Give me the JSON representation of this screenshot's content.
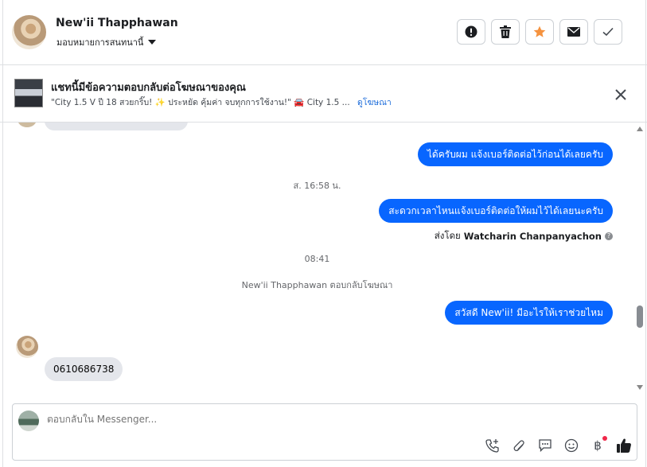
{
  "header": {
    "contact_name": "New'ii Thapphawan",
    "assign_label": "มอบหมายการสนทนานี้",
    "actions": [
      "spam-icon",
      "trash-icon",
      "star-icon",
      "envelope-icon",
      "check-icon"
    ]
  },
  "ad": {
    "title": "แชทนี้มีข้อความตอบกลับต่อโฆษณาของคุณ",
    "preview": "\"City 1.5 V ปี 18 สวยกริ๊บ! ✨ ประหยัด คุ้มค่า จบทุกการใช้งาน!\" 🚘 City 1.5 ...",
    "link": "ดูโฆษณา"
  },
  "messages": {
    "out1": "ได้ครับผม แจ้งเบอร์ติดต่อไว้ก่อนได้เลยครับ",
    "time1": "ส. 16:58 น.",
    "out2": "สะดวกเวลาไหนแจ้งเบอร์ติดต่อให้ผมไว้ได้เลยนะครับ",
    "sent_by_prefix": "ส่งโดย",
    "sent_by_name": "Watcharin Chanpanyachon",
    "time2": "08:41",
    "ad_reply_note": "New'ii Thapphawan ตอบกลับโฆษณา",
    "out3": "สวัสดี New'ii! มีอะไรให้เราช่วยไหม",
    "in1": "0610686738"
  },
  "composer": {
    "placeholder": "ตอบกลับใน Messenger...",
    "tools": [
      "phone-add-icon",
      "attach-icon",
      "saved-replies-icon",
      "emoji-icon",
      "baht-icon",
      "like-icon"
    ]
  },
  "colors": {
    "accent": "#0866ff",
    "incoming": "#e4e6eb",
    "star": "#f5923e",
    "notification": "#f02849"
  }
}
